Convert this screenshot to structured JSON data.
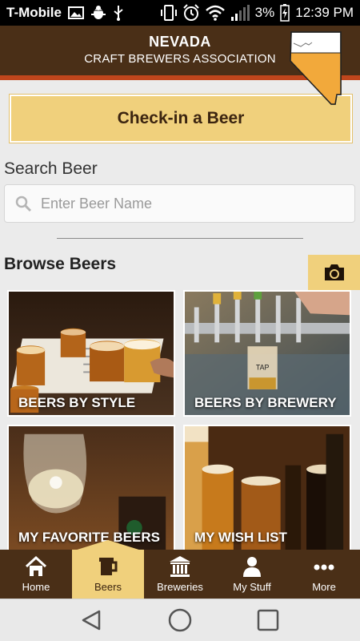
{
  "status_bar": {
    "carrier": "T-Mobile",
    "battery": "3%",
    "time": "12:39 PM",
    "icons": [
      "image-icon",
      "bug-icon",
      "usb-icon",
      "vibrate-icon",
      "alarm-icon",
      "wifi-icon",
      "signal-icon",
      "battery-icon"
    ]
  },
  "header": {
    "title": "NEVADA",
    "subtitle": "CRAFT BREWERS ASSOCIATION",
    "logo_icon": "nevada-state-logo"
  },
  "checkin": {
    "label": "Check-in a Beer"
  },
  "search": {
    "label": "Search Beer",
    "placeholder": "Enter Beer Name",
    "value": ""
  },
  "browse": {
    "title": "Browse Beers",
    "camera_icon": "camera-icon",
    "tiles": [
      {
        "label": "BEERS BY STYLE"
      },
      {
        "label": "BEERS BY BREWERY"
      },
      {
        "label": "MY FAVORITE BEERS"
      },
      {
        "label": "MY WISH LIST"
      }
    ]
  },
  "tabs": [
    {
      "label": "Home",
      "icon": "home-icon",
      "active": false
    },
    {
      "label": "Beers",
      "icon": "beer-mug-icon",
      "active": true
    },
    {
      "label": "Breweries",
      "icon": "building-icon",
      "active": false
    },
    {
      "label": "My Stuff",
      "icon": "user-icon",
      "active": false
    },
    {
      "label": "More",
      "icon": "more-icon",
      "active": false
    }
  ],
  "nav_bar": [
    "back-icon",
    "home-circle-icon",
    "recents-icon"
  ],
  "colors": {
    "header_brown": "#4a2f17",
    "accent_orange": "#c0461c",
    "gold": "#f0d07c",
    "background": "#ebebeb"
  }
}
